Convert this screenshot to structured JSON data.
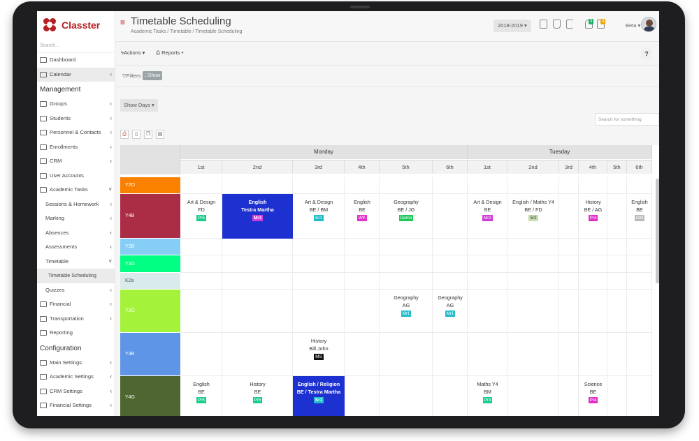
{
  "app": {
    "name": "Classter"
  },
  "sidebar": {
    "search_placeholder": "Search...",
    "items": [
      {
        "label": "Dashboard",
        "icon": "monitor-icon"
      },
      {
        "label": "Calendar",
        "icon": "calendar-icon",
        "chevron": "‹",
        "active": true
      }
    ],
    "management_heading": "Management",
    "management": [
      {
        "label": "Groups",
        "icon": "groups-icon",
        "chevron": "‹"
      },
      {
        "label": "Students",
        "icon": "user-icon",
        "chevron": "‹"
      },
      {
        "label": "Personnel & Contacts",
        "icon": "contacts-icon",
        "chevron": "‹"
      },
      {
        "label": "Enrollments",
        "icon": "enroll-icon",
        "chevron": "‹"
      },
      {
        "label": "CRM",
        "icon": "crm-icon",
        "chevron": "‹"
      },
      {
        "label": "User Accounts",
        "icon": "key-icon"
      },
      {
        "label": "Academic Tasks",
        "icon": "tasks-icon",
        "chevron": "˅"
      }
    ],
    "academic_sub": [
      {
        "label": "Sessions & Homework",
        "chevron": "‹"
      },
      {
        "label": "Marking",
        "chevron": "‹"
      },
      {
        "label": "Absences",
        "chevron": "‹"
      },
      {
        "label": "Assessments",
        "chevron": "‹"
      },
      {
        "label": "Timetable",
        "chevron": "˅"
      }
    ],
    "timetable_sub": [
      {
        "label": "Timetable Scheduling"
      }
    ],
    "after_sub": [
      {
        "label": "Quizzes",
        "chevron": "‹",
        "sub": true
      },
      {
        "label": "Financial",
        "icon": "money-icon",
        "chevron": "‹"
      },
      {
        "label": "Transportation",
        "icon": "bus-icon",
        "chevron": "‹"
      },
      {
        "label": "Reporting",
        "icon": "print-icon"
      }
    ],
    "configuration_heading": "Configuration",
    "configuration": [
      {
        "label": "Main Settings",
        "icon": "sliders-icon",
        "chevron": "‹"
      },
      {
        "label": "Academic Settings",
        "icon": "groups-icon",
        "chevron": "‹"
      },
      {
        "label": "CRM Settings",
        "icon": "crm-icon",
        "chevron": "‹"
      },
      {
        "label": "Financial Settings",
        "icon": "money-icon",
        "chevron": "‹"
      }
    ]
  },
  "header": {
    "title": "Timetable Scheduling",
    "breadcrumb": "Academic Tasks  /  Timetable  /  Timetable Scheduling",
    "year": "2018-2019 ▾",
    "badge1": "3",
    "badge2": "4",
    "beta": "Beta ▾"
  },
  "actions": {
    "actions_label": "Actions ▾",
    "reports_label": "Reports ▾",
    "help": "?"
  },
  "filters": {
    "label": "Filters",
    "show": "Show"
  },
  "toolbar": {
    "show_days": "Show Days ▾",
    "search_placeholder": "Search for something"
  },
  "timetable": {
    "days": [
      {
        "name": "Monday"
      },
      {
        "name": "Tuesday"
      }
    ],
    "monday_periods": [
      "1st",
      "2nd",
      "3rd",
      "4th",
      "5th",
      "6th"
    ],
    "tuesday_periods": [
      "1st",
      "2nd",
      "3rd",
      "4th",
      "5th",
      "6th"
    ],
    "rows": [
      {
        "label": "Y2O",
        "color": "#fa8000"
      },
      {
        "label": "Y4B",
        "color": "#ab2c45"
      },
      {
        "label": "Y2B",
        "color": "#87cef7"
      },
      {
        "label": "Y3G",
        "color": "#00ff82"
      },
      {
        "label": "K2a",
        "color": "#d9ebec"
      },
      {
        "label": "Y2G",
        "color": "#a4f33a"
      },
      {
        "label": "Y3B",
        "color": "#5f95e6"
      },
      {
        "label": "Y4G",
        "color": "#4e6730"
      }
    ],
    "lessons": [
      {
        "row": 1,
        "col": 0,
        "subject": "Art & Design",
        "teacher": "FD",
        "room": "Pr5",
        "room_color": "#18cc8a"
      },
      {
        "row": 1,
        "col": 1,
        "subject": "English",
        "teacher": "Testra Martha",
        "room": "Mr3",
        "room_color": "#d03ad6",
        "highlight": "#1d31d1"
      },
      {
        "row": 1,
        "col": 2,
        "subject": "Art & Design",
        "teacher": "BE / BM",
        "room": "Kr1",
        "room_color": "#1fbcc9"
      },
      {
        "row": 1,
        "col": 3,
        "subject": "English",
        "teacher": "BE",
        "room": "WK",
        "room_color": "#e030c9"
      },
      {
        "row": 1,
        "col": 4,
        "subject": "Geography",
        "teacher": "BE / JG",
        "room": "Demo",
        "room_color": "#1ec85a"
      },
      {
        "row": 1,
        "col": 6,
        "subject": "Art & Design",
        "teacher": "BE",
        "room": "Mr3",
        "room_color": "#d03ad6"
      },
      {
        "row": 1,
        "col": 7,
        "subject": "English / Maths Y4",
        "teacher": "BE / FD",
        "room": "5r2",
        "room_color": "#c6ddb0",
        "room_text": "#333"
      },
      {
        "row": 1,
        "col": 9,
        "subject": "History",
        "teacher": "BE / AG",
        "room": "Pr4",
        "room_color": "#e030c9"
      },
      {
        "row": 1,
        "col": 11,
        "subject": "English",
        "teacher": "BE",
        "room": "GM",
        "room_color": "#bbbbbb"
      },
      {
        "row": 5,
        "col": 4,
        "subject": "Geography",
        "teacher": "AG",
        "room": "Mr1",
        "room_color": "#1fbcc9"
      },
      {
        "row": 5,
        "col": 5,
        "subject": "Geography",
        "teacher": "AG",
        "room": "Mr1",
        "room_color": "#1fbcc9"
      },
      {
        "row": 6,
        "col": 2,
        "subject": "History",
        "teacher": "Bill John",
        "room": "MS",
        "room_color": "#111111"
      },
      {
        "row": 7,
        "col": 0,
        "subject": "English",
        "teacher": "BE",
        "room": "Pr5",
        "room_color": "#18cc8a"
      },
      {
        "row": 7,
        "col": 1,
        "subject": "History",
        "teacher": "BE",
        "room": "Pr5",
        "room_color": "#18cc8a"
      },
      {
        "row": 7,
        "col": 2,
        "subject": "English / Religion",
        "teacher": "BE / Testra Martha",
        "room": "Sr1",
        "room_color": "#1fbcc9",
        "highlight": "#1d31d1"
      },
      {
        "row": 7,
        "col": 6,
        "subject": "Maths Y4",
        "teacher": "BM",
        "room": "Pr3",
        "room_color": "#18cc8a"
      },
      {
        "row": 7,
        "col": 9,
        "subject": "Science",
        "teacher": "BE",
        "room": "Pr4",
        "room_color": "#e030c9"
      }
    ]
  },
  "colors": {
    "brand": "#b52025",
    "highlight_cell": "#1d31d1"
  }
}
